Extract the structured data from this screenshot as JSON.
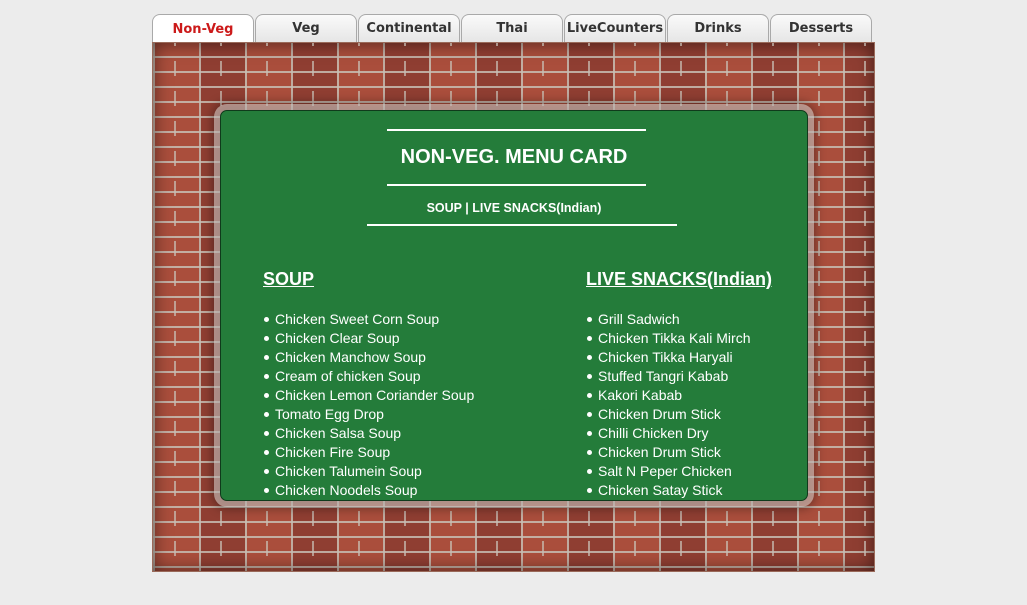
{
  "tabs": [
    {
      "label": "Non-Veg",
      "active": true
    },
    {
      "label": "Veg",
      "active": false
    },
    {
      "label": "Continental",
      "active": false
    },
    {
      "label": "Thai",
      "active": false
    },
    {
      "label": "LiveCounters",
      "active": false
    },
    {
      "label": "Drinks",
      "active": false
    },
    {
      "label": "Desserts",
      "active": false
    }
  ],
  "menu": {
    "title": "NON-VEG. MENU CARD",
    "subtitle_links": [
      "SOUP",
      "LIVE SNACKS(Indian)"
    ],
    "subtitle_separator": "|",
    "sections": [
      {
        "heading": "SOUP",
        "items": [
          "Chicken Sweet Corn Soup",
          "Chicken Clear Soup",
          "Chicken Manchow Soup",
          "Cream of chicken Soup",
          "Chicken Lemon Coriander Soup",
          "Tomato Egg Drop",
          "Chicken Salsa Soup",
          "Chicken Fire Soup",
          "Chicken Talumein Soup",
          "Chicken Noodels Soup"
        ]
      },
      {
        "heading": "LIVE SNACKS(Indian)",
        "items": [
          "Grill Sadwich",
          "Chicken Tikka Kali Mirch",
          "Chicken Tikka Haryali",
          "Stuffed Tangri Kabab",
          "Kakori Kabab",
          "Chicken Drum Stick",
          "Chilli Chicken Dry",
          "Chicken Drum Stick",
          "Salt N Peper Chicken",
          "Chicken Satay Stick"
        ]
      }
    ]
  },
  "colors": {
    "board": "#247c3a",
    "active_tab_text": "#cc1a1a",
    "page_bg": "#ececec"
  }
}
